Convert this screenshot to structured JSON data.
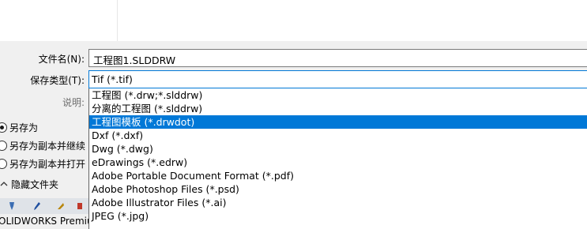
{
  "form": {
    "filename_label": "文件名(N):",
    "filename_value": "工程图1.SLDDRW",
    "type_label": "保存类型(T):",
    "type_value": "Tif (*.tif)",
    "description_label": "说明:"
  },
  "dropdown": {
    "options": [
      "工程图 (*.drw;*.slddrw)",
      "分离的工程图 (*.slddrw)",
      "工程图模板 (*.drwdot)",
      "Dxf (*.dxf)",
      "Dwg (*.dwg)",
      "eDrawings (*.edrw)",
      "Adobe Portable Document Format (*.pdf)",
      "Adobe Photoshop Files (*.psd)",
      "Adobe Illustrator Files (*.ai)",
      "JPEG (*.jpg)"
    ],
    "highlighted": "工程图模板 (*.drwdot)"
  },
  "save_options": {
    "save_as": "另存为",
    "save_as_copy_continue": "另存为副本并继续",
    "save_as_copy_open": "另存为副本并打开",
    "selected": "另存为"
  },
  "hide_folders_label": "隐藏文件夹",
  "app_name": "OLIDWORKS Premiu",
  "colors": {
    "selection": "#0078d7",
    "panel": "#f0f0f0"
  }
}
